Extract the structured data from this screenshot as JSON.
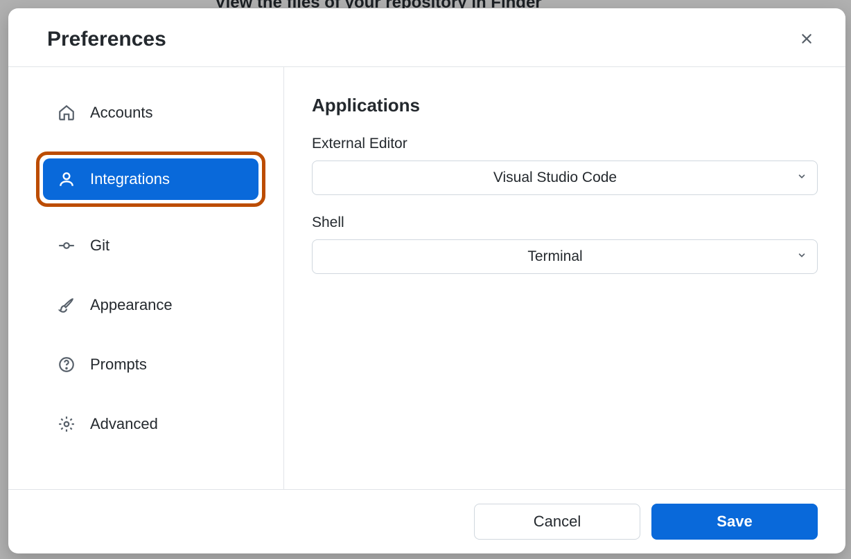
{
  "backdrop": {
    "text": "View the files of your repository in Finder"
  },
  "dialog": {
    "title": "Preferences"
  },
  "sidebar": {
    "items": [
      {
        "label": "Accounts"
      },
      {
        "label": "Integrations"
      },
      {
        "label": "Git"
      },
      {
        "label": "Appearance"
      },
      {
        "label": "Prompts"
      },
      {
        "label": "Advanced"
      }
    ]
  },
  "content": {
    "section_title": "Applications",
    "external_editor": {
      "label": "External Editor",
      "value": "Visual Studio Code"
    },
    "shell": {
      "label": "Shell",
      "value": "Terminal"
    }
  },
  "footer": {
    "cancel": "Cancel",
    "save": "Save"
  }
}
